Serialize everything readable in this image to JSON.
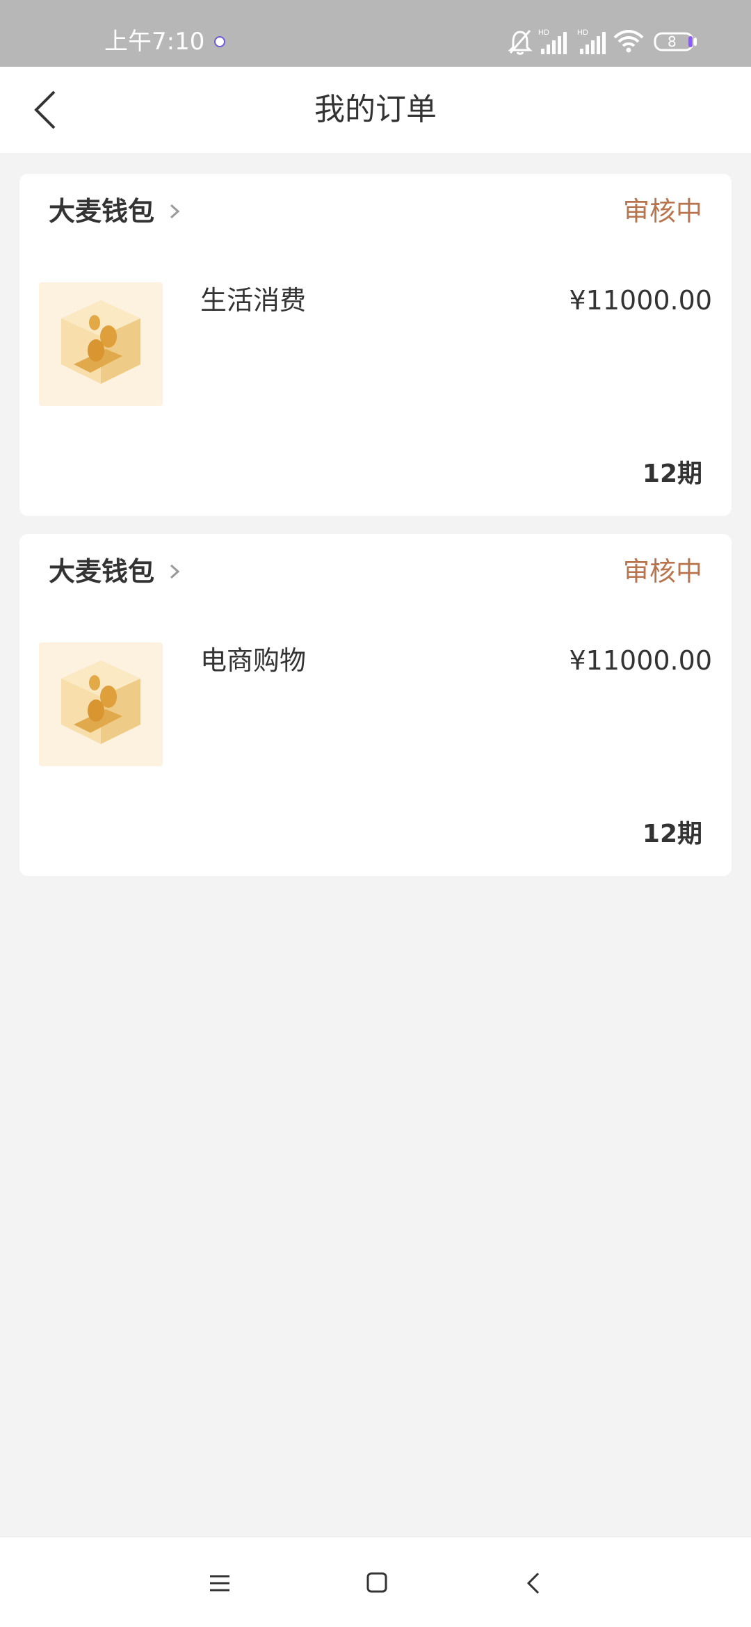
{
  "status_bar": {
    "time": "上午7:10",
    "battery_level": "8",
    "icons": [
      "notification-dot-icon",
      "bell-off-icon",
      "hd-signal-icon",
      "hd-signal-icon",
      "wifi-icon",
      "battery-icon"
    ]
  },
  "header": {
    "title": "我的订单",
    "back_icon": "chevron-left-icon"
  },
  "orders": [
    {
      "merchant": "大麦钱包",
      "status": "审核中",
      "product": "生活消费",
      "price": "¥11000.00",
      "term": "12期",
      "thumbnail_icon": "gold-coin-box-icon"
    },
    {
      "merchant": "大麦钱包",
      "status": "审核中",
      "product": "电商购物",
      "price": "¥11000.00",
      "term": "12期",
      "thumbnail_icon": "gold-coin-box-icon"
    }
  ],
  "system_nav": {
    "icons": [
      "menu-icon",
      "home-icon",
      "back-icon"
    ]
  },
  "colors": {
    "accent_status": "#b8744d",
    "status_bar_bg": "#b7b7b7",
    "page_bg": "#f3f3f3"
  }
}
